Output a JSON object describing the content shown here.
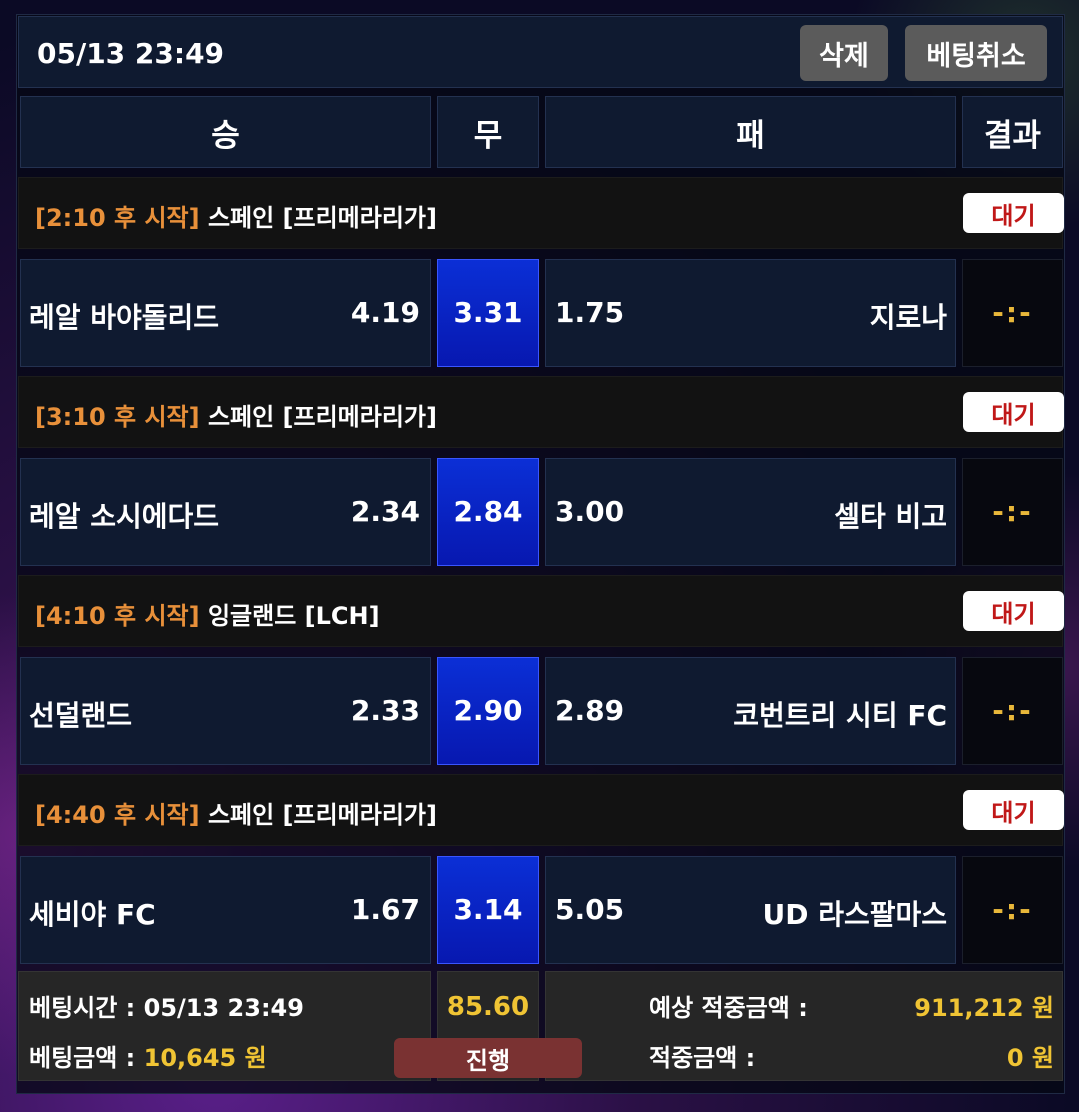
{
  "header": {
    "datetime": "05/13 23:49",
    "delete_label": "삭제",
    "cancel_label": "베팅취소"
  },
  "columns": {
    "win": "승",
    "draw": "무",
    "lose": "패",
    "result": "결과"
  },
  "matches": [
    {
      "start_time": "[2:10 후 시작]",
      "league": "스페인 [프리메라리가]",
      "status": "대기",
      "home": "레알 바야돌리드",
      "home_odds": "4.19",
      "draw_odds": "3.31",
      "away_odds": "1.75",
      "away": "지로나",
      "score": "-:-"
    },
    {
      "start_time": "[3:10 후 시작]",
      "league": "스페인 [프리메라리가]",
      "status": "대기",
      "home": "레알 소시에다드",
      "home_odds": "2.34",
      "draw_odds": "2.84",
      "away_odds": "3.00",
      "away": "셀타 비고",
      "score": "-:-"
    },
    {
      "start_time": "[4:10 후 시작]",
      "league": "잉글랜드 [LCH]",
      "status": "대기",
      "home": "선덜랜드",
      "home_odds": "2.33",
      "draw_odds": "2.90",
      "away_odds": "2.89",
      "away": "코번트리 시티 FC",
      "score": "-:-"
    },
    {
      "start_time": "[4:40 후 시작]",
      "league": "스페인 [프리메라리가]",
      "status": "대기",
      "home": "세비야 FC",
      "home_odds": "1.67",
      "draw_odds": "3.14",
      "away_odds": "5.05",
      "away": "UD 라스팔마스",
      "score": "-:-"
    }
  ],
  "footer": {
    "bet_time_label": "베팅시간 : ",
    "bet_time_value": "05/13 23:49",
    "bet_amount_label": "베팅금액 : ",
    "bet_amount_value": "10,645 원",
    "total_odds": "85.60",
    "progress_label": "진행",
    "expected_label": "예상 적중금액 :",
    "expected_value": "911,212 원",
    "won_label": "적중금액 :",
    "won_value": "0 원"
  },
  "colors": {
    "start_time": "#e8903a",
    "status_text": "#c01818",
    "draw_cell": "#0b2fd6",
    "result_score": "#e8b73a",
    "amount_highlight": "#f0c434",
    "progress_badge": "#7a3232"
  }
}
